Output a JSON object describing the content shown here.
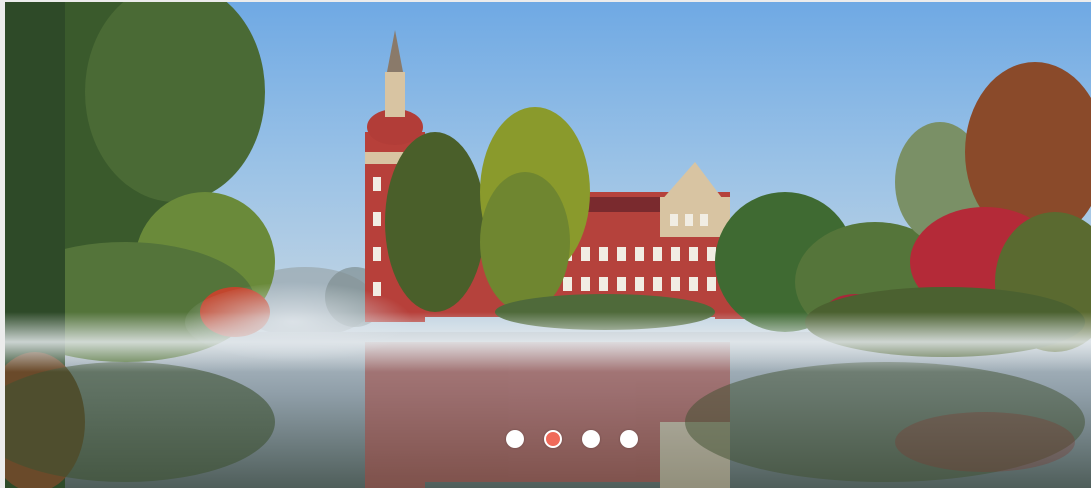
{
  "carousel": {
    "slide_subject": "castle-lake-landscape",
    "active_index": 1,
    "indicators": [
      {
        "active": false
      },
      {
        "active": true
      },
      {
        "active": false
      },
      {
        "active": false
      }
    ],
    "colors": {
      "indicator_inactive": "#ffffff",
      "indicator_active": "#f06a5a",
      "sky_top": "#7fb3e6",
      "castle_brick": "#b5423c"
    }
  }
}
